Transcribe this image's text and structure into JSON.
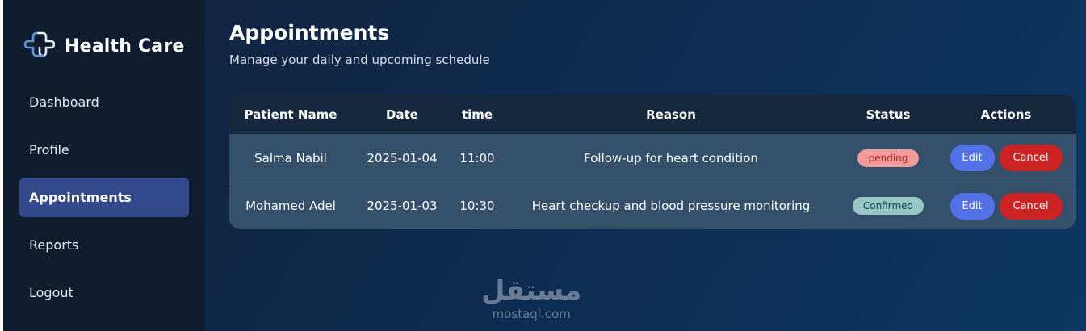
{
  "brand": {
    "name": "Health Care",
    "logo_icon": "medical-cross-icon"
  },
  "sidebar": {
    "items": [
      {
        "label": "Dashboard",
        "active": false
      },
      {
        "label": "Profile",
        "active": false
      },
      {
        "label": "Appointments",
        "active": true
      },
      {
        "label": "Reports",
        "active": false
      },
      {
        "label": "Logout",
        "active": false
      }
    ]
  },
  "page": {
    "title": "Appointments",
    "subtitle": "Manage your daily and upcoming schedule"
  },
  "table": {
    "headers": [
      "Patient Name",
      "Date",
      "time",
      "Reason",
      "Status",
      "Actions"
    ],
    "rows": [
      {
        "patient": "Salma Nabil",
        "date": "2025-01-04",
        "time": "11:00",
        "reason": "Follow-up for heart condition",
        "status": "pending"
      },
      {
        "patient": "Mohamed Adel",
        "date": "2025-01-03",
        "time": "10:30",
        "reason": "Heart checkup and blood pressure monitoring",
        "status": "Confirmed"
      }
    ],
    "actions": {
      "edit_label": "Edit",
      "cancel_label": "Cancel"
    }
  },
  "colors": {
    "accent": "#33498b",
    "edit_button": "#5271e6",
    "cancel_button": "#cc2424",
    "pending_badge": "#f19b9b",
    "confirmed_badge": "#98c7c3"
  },
  "watermark": {
    "arabic": "مستقل",
    "latin": "mostaql.com"
  }
}
